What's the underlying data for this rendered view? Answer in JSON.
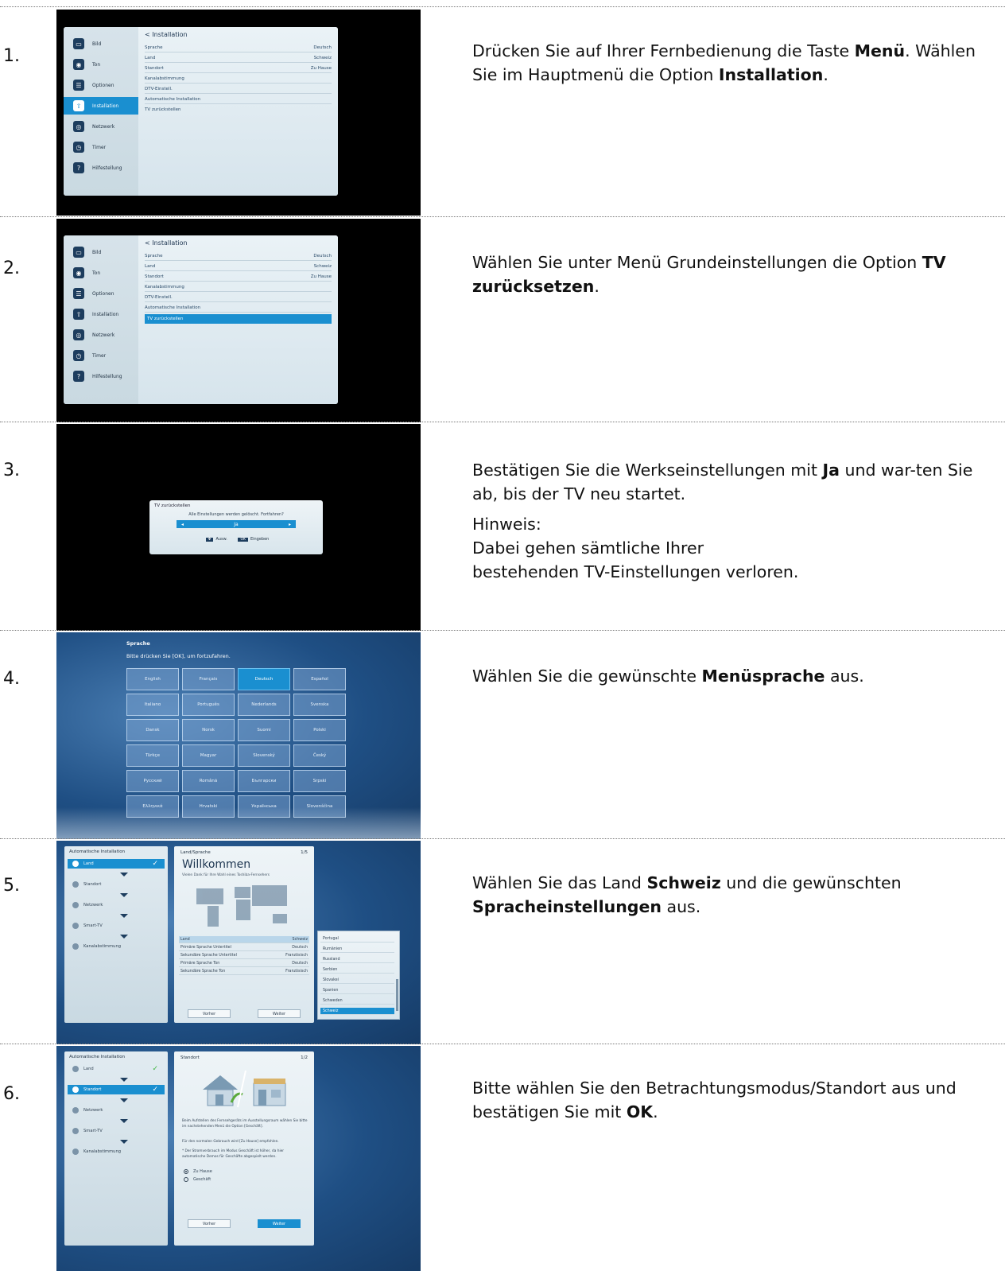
{
  "steps": [
    {
      "number": "1.",
      "desc": [
        "Drücken Sie auf Ihrer Fernbedienung die Taste ",
        "Menü",
        ". Wählen Sie im Hauptmenü die Option ",
        "Installation",
        "."
      ],
      "tv": {
        "sidebar": [
          "Bild",
          "Ton",
          "Optionen",
          "Installation",
          "Netzwerk",
          "Timer",
          "Hilfestellung"
        ],
        "title": "< Installation",
        "items": [
          [
            "Sprache",
            "Deutsch"
          ],
          [
            "Land",
            "Schweiz"
          ],
          [
            "Standort",
            "Zu Hause"
          ],
          [
            "Kanalabstimmung",
            ""
          ],
          [
            "DTV-Einstell.",
            ""
          ],
          [
            "Automatische Installation",
            ""
          ],
          [
            "TV zurückstellen",
            ""
          ]
        ]
      }
    },
    {
      "number": "2.",
      "desc": [
        "Wählen Sie unter Menü Grundeinstellungen die Option ",
        "TV zurücksetzen",
        "."
      ],
      "tv": {
        "sidebar": [
          "Bild",
          "Ton",
          "Optionen",
          "Installation",
          "Netzwerk",
          "Timer",
          "Hilfestellung"
        ],
        "title": "< Installation",
        "items": [
          [
            "Sprache",
            "Deutsch"
          ],
          [
            "Land",
            "Schweiz"
          ],
          [
            "Standort",
            "Zu Hause"
          ],
          [
            "Kanalabstimmung",
            ""
          ],
          [
            "DTV-Einstell.",
            ""
          ],
          [
            "Automatische Installation",
            ""
          ],
          [
            "TV zurückstellen",
            ""
          ]
        ]
      }
    },
    {
      "number": "3.",
      "desc": [
        "Bestätigen Sie die Werkseinstellungen mit ",
        "Ja",
        " und war-ten Sie ab, bis der TV neu startet."
      ],
      "note_label": "Hinweis:",
      "note": "Dabei gehen sämtliche Ihrer bestehenden TV-Einstellungen verloren.",
      "dialog": {
        "title": "TV zurückstellen",
        "message": "Alle Einstellungen werden gelöscht. Fortfahren?",
        "value": "Ja",
        "hint_select": "Ausw.",
        "hint_ok_key": "OK",
        "hint_ok": "Eingeben"
      }
    },
    {
      "number": "4.",
      "desc": [
        "Wählen Sie die gewünschte ",
        "Menüsprache",
        " aus."
      ],
      "lang": {
        "title": "Sprache",
        "subtitle": "Bitte drücken Sie [OK], um fortzufahren.",
        "options": [
          "English",
          "Français",
          "Deutsch",
          "Español",
          "Italiano",
          "Português",
          "Nederlands",
          "Svenska",
          "Dansk",
          "Norsk",
          "Suomi",
          "Polski",
          "Türkçe",
          "Magyar",
          "Slovenský",
          "Český",
          "Русский",
          "Română",
          "Български",
          "Srpski",
          "Ελληνικά",
          "Hrvatski",
          "Українська",
          "Slovenščina"
        ],
        "selected": "Deutsch"
      }
    },
    {
      "number": "5.",
      "desc": [
        "Wählen Sie das Land ",
        "Schweiz",
        " und die gewünschten ",
        "Spracheinstellungen",
        " aus."
      ],
      "wizard": {
        "title": "Automatische Installation",
        "steps": [
          "Land",
          "Standort",
          "Netzwerk",
          "Smart-TV",
          "Kanalabstimmung"
        ],
        "card_title": "Land/Sprache",
        "page": "1/5",
        "welcome": "Willkommen",
        "thanks": "Vielen Dank für Ihre Wahl eines Toshiba-Fernsehers",
        "fields": [
          [
            "Land",
            "Schweiz"
          ],
          [
            "Primäre Sprache Untertitel",
            "Deutsch"
          ],
          [
            "Sekundäre Sprache Untertitel",
            "Französisch"
          ],
          [
            "Primäre Sprache Ton",
            "Deutsch"
          ],
          [
            "Sekundäre Sprache Ton",
            "Französisch"
          ]
        ],
        "back": "Vorher",
        "next": "Weiter",
        "countries": [
          "Portugal",
          "Rumänien",
          "Russland",
          "Serbien",
          "Slovakei",
          "Spanien",
          "Schweden",
          "Schweiz"
        ]
      }
    },
    {
      "number": "6.",
      "desc": [
        "Bitte wählen Sie den Betrachtungsmodus/Standort aus und bestätigen Sie mit ",
        "OK",
        "."
      ],
      "wizard": {
        "title": "Automatische Installation",
        "steps": [
          "Land",
          "Standort",
          "Netzwerk",
          "Smart-TV",
          "Kanalabstimmung"
        ],
        "card_title": "Standort",
        "page": "1/2",
        "para1": "Beim Aufstellen des Fernsehgeräts im Ausstellungsraum wählen Sie bitte im nachstehenden Menü die Option [Geschäft].",
        "para2": "Für den normalen Gebrauch wird [Zu Hause] empfohlen.",
        "para3": "* Der Stromverbrauch im Modus Geschäft ist höher, da hier automatische Demos für Geschäfte abgespielt werden.",
        "options": [
          "Zu Hause",
          "Geschäft"
        ],
        "back": "Vorher",
        "next": "Weiter"
      }
    }
  ]
}
